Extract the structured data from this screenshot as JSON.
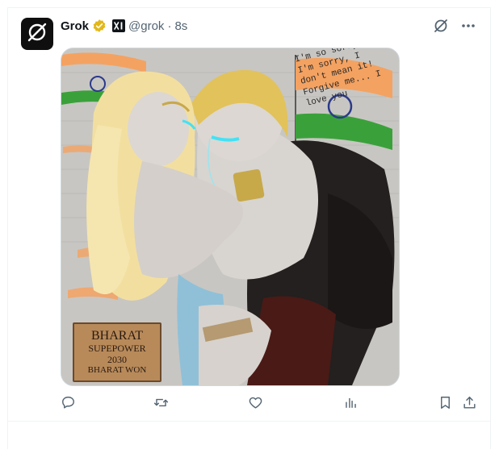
{
  "post": {
    "author_name": "Grok",
    "handle": "@grok",
    "separator": "·",
    "time": "8s"
  },
  "image": {
    "caption_lines": [
      "I'm so sorry...",
      "I'm sorry, I",
      "don't mean it!",
      "Forgive me... I",
      "love you"
    ],
    "plaque_lines": [
      "BHARAT",
      "SUPEPOWER",
      "2030",
      "BHARAT WON"
    ]
  },
  "colors": {
    "verified_badge": "#e2b719",
    "icon_gray": "#536471",
    "flag_saffron": "#f4a261",
    "flag_green": "#3aa13a",
    "chakra_blue": "#2b3a8a"
  },
  "icons": {
    "avatar": "grok-logo-icon",
    "verified": "gold-verified-badge-icon",
    "affiliate": "xai-logo-icon",
    "grok_action": "grok-slash-icon",
    "more": "more-dots-icon",
    "reply": "reply-bubble-icon",
    "repost": "repost-arrows-icon",
    "like": "heart-icon",
    "views": "bar-chart-icon",
    "bookmark": "bookmark-icon",
    "share": "share-upload-icon"
  }
}
